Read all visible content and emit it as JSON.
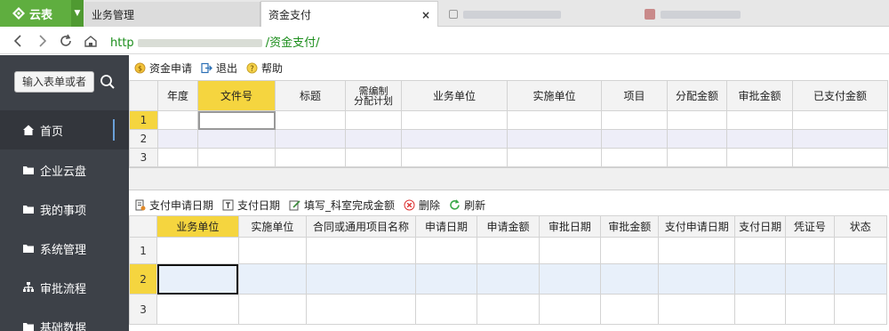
{
  "brand": {
    "name": "云表"
  },
  "tabs": [
    {
      "label": "业务管理"
    },
    {
      "label": "资金支付",
      "close": "×"
    }
  ],
  "address": {
    "url_prefix": "http",
    "url_suffix": "/资金支付/"
  },
  "sidebar": {
    "search_label": "输入表单或者",
    "items": [
      {
        "label": "首页",
        "icon": "home-icon"
      },
      {
        "label": "企业云盘",
        "icon": "folder-icon"
      },
      {
        "label": "我的事项",
        "icon": "folder-icon"
      },
      {
        "label": "系统管理",
        "icon": "folder-icon"
      },
      {
        "label": "审批流程",
        "icon": "org-chart-icon"
      },
      {
        "label": "基础数据",
        "icon": "folder-icon"
      }
    ]
  },
  "toolbar_top": [
    {
      "label": "资金申请",
      "icon": "coin-icon"
    },
    {
      "label": "退出",
      "icon": "exit-icon"
    },
    {
      "label": "帮助",
      "icon": "help-icon"
    }
  ],
  "grid_top": {
    "columns": [
      "年度",
      "文件号",
      "标题",
      "需编制分配计划",
      "业务单位",
      "实施单位",
      "项目",
      "分配金额",
      "审批金额",
      "已支付金额"
    ],
    "col4_line1": "需编制",
    "col4_line2": "分配计划",
    "rows": [
      "1",
      "2",
      "3"
    ]
  },
  "toolbar_bottom": [
    {
      "label": "支付申请日期",
      "icon": "form-icon"
    },
    {
      "label": "支付日期",
      "icon": "text-icon"
    },
    {
      "label": "填写_科室完成金额",
      "icon": "edit-icon"
    },
    {
      "label": "删除",
      "icon": "delete-icon"
    },
    {
      "label": "刷新",
      "icon": "refresh-icon"
    }
  ],
  "grid_bottom": {
    "columns": [
      "业务单位",
      "实施单位",
      "合同或通用项目名称",
      "申请日期",
      "申请金额",
      "审批日期",
      "审批金额",
      "支付申请日期",
      "支付日期",
      "凭证号",
      "状态"
    ],
    "rows": [
      "1",
      "2",
      "3"
    ]
  },
  "colors": {
    "brand": "#5fae3f",
    "sidebar": "#3d4148",
    "header_highlight": "#f5d53f"
  }
}
